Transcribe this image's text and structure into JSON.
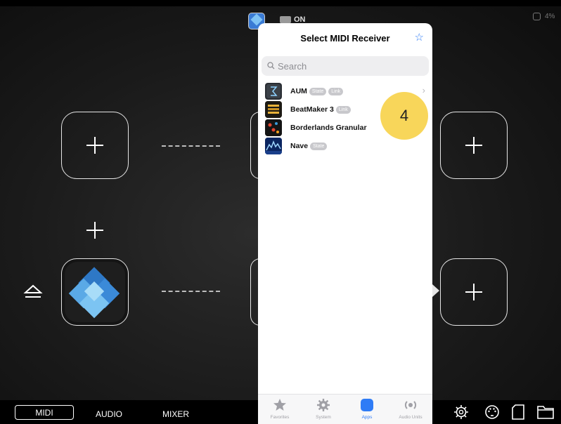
{
  "status_bar": {
    "on_label": "ON",
    "battery": "4%"
  },
  "modal": {
    "title": "Select MIDI Receiver",
    "search_placeholder": "Search",
    "apps": [
      {
        "name": "AUM",
        "badges": [
          "State",
          "Link"
        ],
        "icon": "aum-icon"
      },
      {
        "name": "BeatMaker 3",
        "badges": [
          "Link"
        ],
        "icon": "beatmaker-icon"
      },
      {
        "name": "Borderlands Granular",
        "badges": [],
        "icon": "borderlands-icon"
      },
      {
        "name": "Nave",
        "badges": [
          "State"
        ],
        "icon": "nave-icon"
      }
    ],
    "tabs": [
      {
        "label": "Favorites",
        "icon": "star-icon"
      },
      {
        "label": "System",
        "icon": "gear-icon"
      },
      {
        "label": "Apps",
        "icon": "apps-icon",
        "active": true
      },
      {
        "label": "Audio Units",
        "icon": "audio-units-icon"
      }
    ]
  },
  "annotation": {
    "step": "4",
    "color": "#f8d65a"
  },
  "bottom_bar": {
    "tabs": [
      {
        "label": "MIDI",
        "selected": true
      },
      {
        "label": "AUDIO"
      },
      {
        "label": "MIXER"
      }
    ]
  },
  "colors": {
    "accent": "#2f7cf6",
    "background": "#1a1a1a"
  }
}
